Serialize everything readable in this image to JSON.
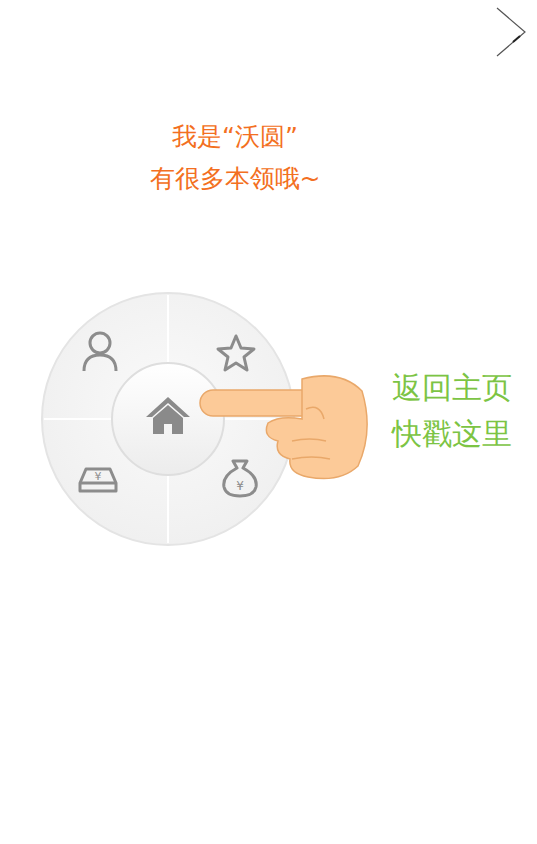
{
  "intro": {
    "lines": [
      "我是“沃圆”",
      "有很多本领哦~"
    ]
  },
  "hint": {
    "lines": [
      "返回主页",
      "快戳这里"
    ]
  }
}
